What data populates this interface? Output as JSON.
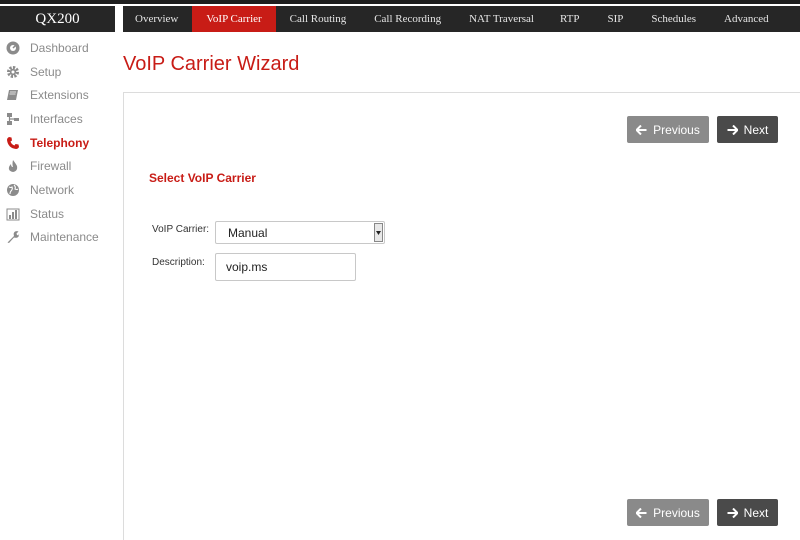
{
  "brand": "QX200",
  "topnav": {
    "tabs": [
      {
        "label": "Overview"
      },
      {
        "label": "VoIP Carrier",
        "active": true
      },
      {
        "label": "Call Routing"
      },
      {
        "label": "Call Recording"
      },
      {
        "label": "NAT Traversal"
      },
      {
        "label": "RTP"
      },
      {
        "label": "SIP"
      },
      {
        "label": "Schedules"
      },
      {
        "label": "Advanced"
      }
    ]
  },
  "sidebar": {
    "items": [
      {
        "label": "Dashboard",
        "icon": "dashboard-icon"
      },
      {
        "label": "Setup",
        "icon": "gear-icon"
      },
      {
        "label": "Extensions",
        "icon": "book-icon"
      },
      {
        "label": "Interfaces",
        "icon": "network-interface-icon"
      },
      {
        "label": "Telephony",
        "icon": "phone-icon",
        "active": true
      },
      {
        "label": "Firewall",
        "icon": "flame-icon"
      },
      {
        "label": "Network",
        "icon": "globe-icon"
      },
      {
        "label": "Status",
        "icon": "bar-chart-icon"
      },
      {
        "label": "Maintenance",
        "icon": "wrench-icon"
      }
    ]
  },
  "page": {
    "title": "VoIP Carrier Wizard"
  },
  "wizard": {
    "previous_label": "Previous",
    "next_label": "Next",
    "section_title": "Select VoIP Carrier",
    "carrier_label": "VoIP Carrier:",
    "carrier_value": "Manual",
    "description_label": "Description:",
    "description_value": "voip.ms"
  },
  "colors": {
    "accent": "#c81c16",
    "nav_bg": "#262626",
    "previous_button": "#8a8a8a",
    "next_button": "#4a4a4a",
    "sidebar_text": "#8b8b8b"
  }
}
